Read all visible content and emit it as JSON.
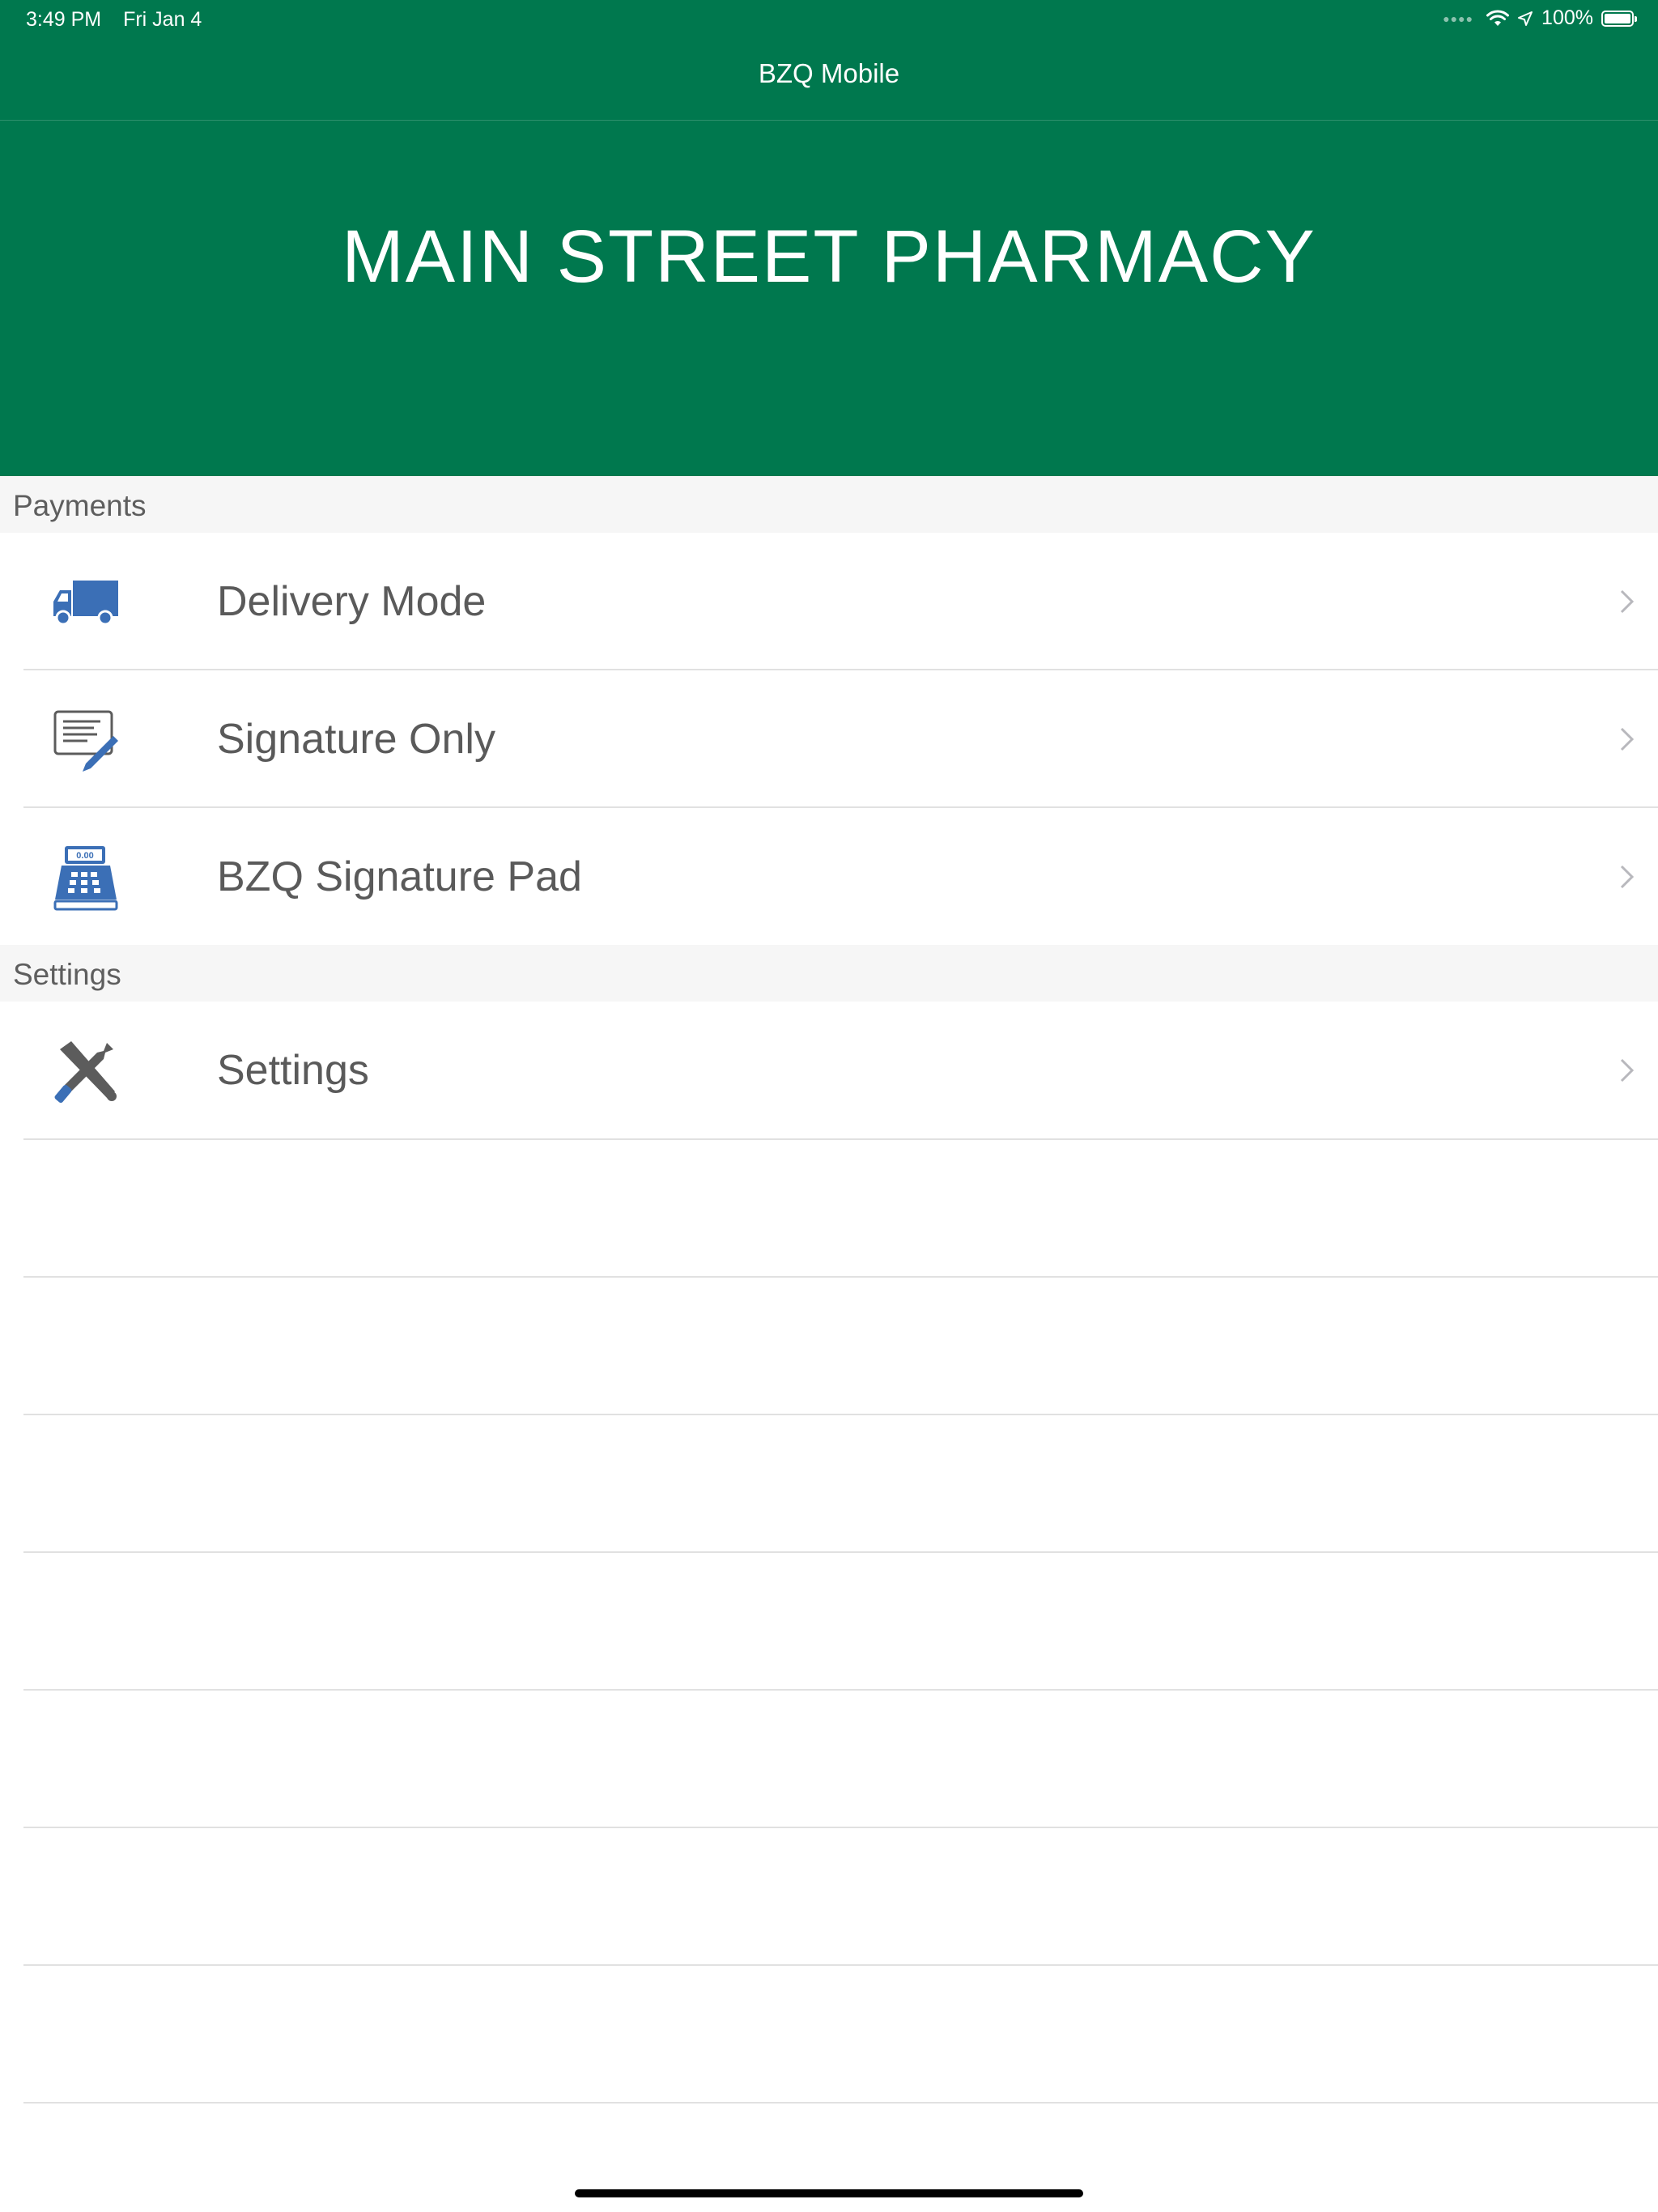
{
  "status_bar": {
    "time": "3:49 PM",
    "date": "Fri Jan 4",
    "battery": "100%",
    "icons": [
      "signal-dots-icon",
      "wifi-icon",
      "location-arrow-icon",
      "battery-icon"
    ]
  },
  "nav": {
    "title": "BZQ Mobile"
  },
  "hero": {
    "title": "MAIN STREET PHARMACY"
  },
  "sections": [
    {
      "header": "Payments",
      "items": [
        {
          "label": "Delivery Mode",
          "icon": "delivery-truck-icon"
        },
        {
          "label": "Signature Only",
          "icon": "signature-document-icon"
        },
        {
          "label": "BZQ Signature Pad",
          "icon": "cash-register-icon",
          "icon_text": "0.00"
        }
      ]
    },
    {
      "header": "Settings",
      "items": [
        {
          "label": "Settings",
          "icon": "tools-icon"
        }
      ]
    }
  ],
  "colors": {
    "brand_green": "#00784e",
    "icon_blue": "#3b6fb6",
    "icon_gray": "#5c5c5c",
    "section_bg": "#f6f6f6",
    "divider": "#e1e1e1"
  }
}
